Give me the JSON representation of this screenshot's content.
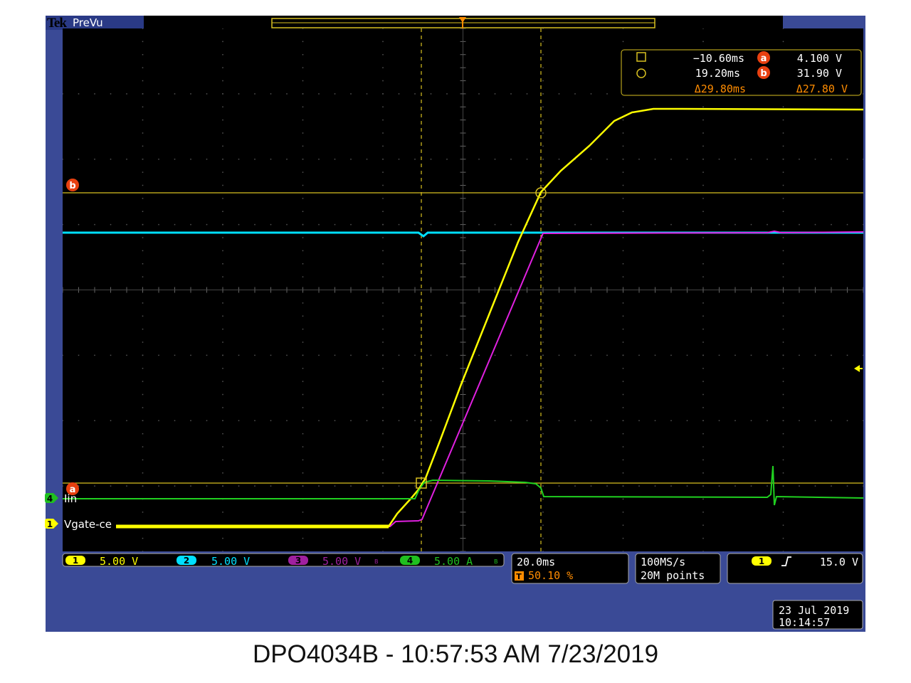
{
  "header": {
    "brand": "Tek",
    "mode": "PreVu",
    "trigger_marker": "T"
  },
  "cursor_readout": {
    "cursor1_time": "−10.60ms",
    "cursor2_time": "19.20ms",
    "delta_time": "Δ29.80ms",
    "marker_a": "a",
    "marker_b": "b",
    "cursor_a_value": "4.100 V",
    "cursor_b_value": "31.90 V",
    "delta_value": "Δ27.80 V"
  },
  "trace_labels": {
    "ch4_num": "4",
    "ch4_name": "Iin",
    "ch1_num": "1",
    "ch1_name": "Vgate-ce",
    "level_a": "a",
    "level_b": "b"
  },
  "channels": [
    {
      "num": "1",
      "scale": "5.00 V",
      "color": "#ffff00"
    },
    {
      "num": "2",
      "scale": "5.00 V",
      "color": "#00e0ff"
    },
    {
      "num": "3",
      "scale": "5.00 V",
      "color": "#c030c0"
    },
    {
      "num": "4",
      "scale": "5.00 A",
      "color": "#20c020"
    }
  ],
  "bandwidth_mark": "B",
  "timebase": {
    "scale": "20.0ms",
    "trigger_pos": "50.10 %"
  },
  "acquisition": {
    "rate": "100MS/s",
    "record": "20M points"
  },
  "trigger": {
    "source": "1",
    "slope_icon": "rising-edge",
    "level": "15.0 V"
  },
  "datetime": {
    "date": "23 Jul  2019",
    "time": "10:14:57"
  },
  "caption": "DPO4034B - 10:57:53 AM   7/23/2019",
  "colors": {
    "ch1": "#ffff00",
    "ch2": "#00e0ff",
    "ch3": "#e020e0",
    "ch4": "#20d020",
    "cursor": "#d8c020",
    "orange": "#ff8c00"
  }
}
